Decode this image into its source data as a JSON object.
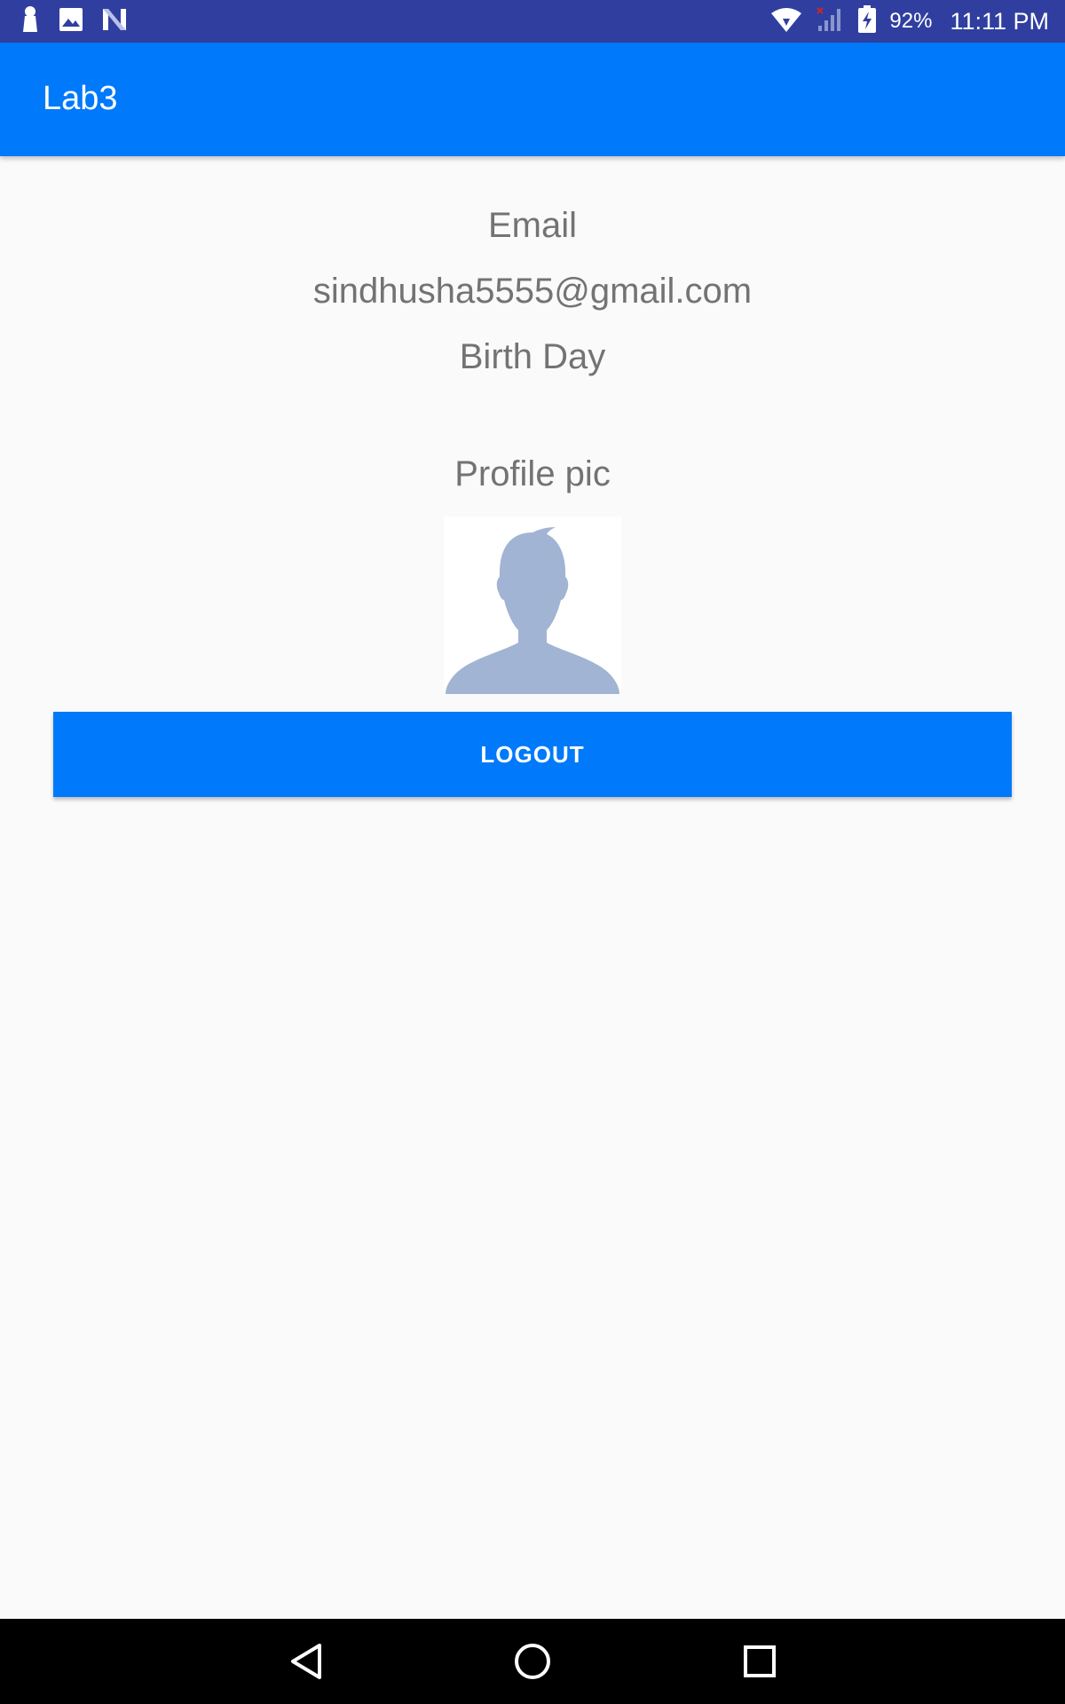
{
  "status_bar": {
    "left_icons": [
      "keyhole-icon",
      "image-icon",
      "n-logo-icon"
    ],
    "right_icons": [
      "wifi-icon",
      "cell-signal-icon",
      "battery-charging-icon"
    ],
    "battery_percent": "92%",
    "time": "11:11 PM",
    "background_color": "#303f9f"
  },
  "app_bar": {
    "title": "Lab3",
    "background_color": "#0079fa"
  },
  "profile": {
    "email_label": "Email",
    "email_value": "sindhusha5555@gmail.com",
    "birthday_label": "Birth Day",
    "profile_pic_label": "Profile pic",
    "avatar_icon": "default-avatar-silhouette"
  },
  "actions": {
    "logout_label": "LOGOUT"
  },
  "nav_bar": {
    "buttons": [
      "back-icon",
      "home-icon",
      "recents-icon"
    ]
  }
}
